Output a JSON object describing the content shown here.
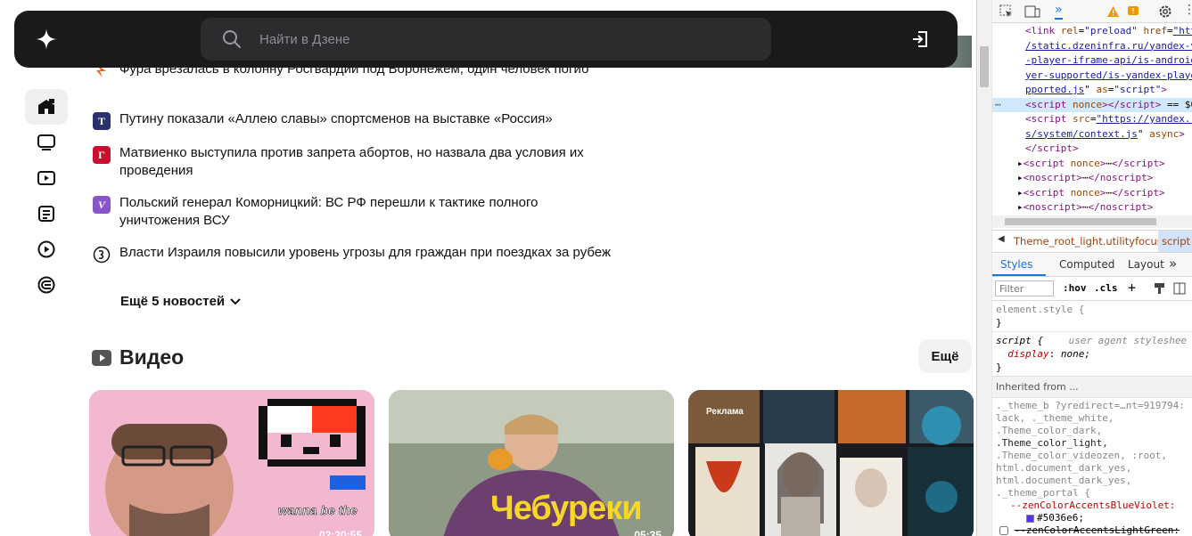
{
  "header": {
    "search_placeholder": "Найти в Дзене"
  },
  "news": [
    {
      "text": "Фура врезалась в колонну Росгвардии под Воронежем, один человек погиб",
      "source_icon": "red-arrow-logo",
      "source_color": "#ff5a1f"
    },
    {
      "text": "Путину показали «Аллею славы» спортсменов на выставке «Россия»",
      "source_icon": "T",
      "source_color": "#2a2f6e"
    },
    {
      "text": "Матвиенко выступила против запрета абортов, но назвала два условия их проведения",
      "source_icon": "Г",
      "source_color": "#c8102e"
    },
    {
      "text": "Польский генерал Коморницкий: ВС РФ перешли к тактике полного уничтожения ВСУ",
      "source_icon": "V",
      "source_color": "#8a55c9"
    },
    {
      "text": "Власти Израиля повысили уровень угрозы для граждан при поездках за рубеж",
      "source_icon": "circle-logo",
      "source_color": "#111111"
    }
  ],
  "more_news_label": "Ещё 5 новостей",
  "video": {
    "title": "Видео",
    "more_label": "Ещё",
    "cards": [
      {
        "duration": "02:20:55",
        "caption": ""
      },
      {
        "duration": "05:35",
        "caption": "Чебуреки"
      },
      {
        "ad_label": "Реклама"
      }
    ]
  },
  "devtools": {
    "dom_lines": [
      {
        "html": "<span class='tag'>&lt;link</span> <span class='attr'>rel</span>=<span class='val'>\"preload\"</span> <span class='attr'>href</span>=<span class='link'>\"htt</span>"
      },
      {
        "html": "<span class='link'>/static.dzeninfra.ru/yandex-v</span>"
      },
      {
        "html": "<span class='link'>-player-iframe-api/is-android</span>"
      },
      {
        "html": "<span class='link'>yer-supported/is-yandex-playe</span>"
      },
      {
        "html": "<span class='link'>pported.js</span>\" <span class='attr'>as</span>=<span class='val'>\"script\"</span><span class='tag'>&gt;</span>"
      },
      {
        "html": "<span class='tag'>&lt;script</span> <span class='attr'>nonce</span><span class='tag'>&gt;&lt;/script&gt;</span> == $0",
        "selected": true
      },
      {
        "html": "<span class='tag'>&lt;script</span> <span class='attr'>src</span>=<span class='link'>\"https://yandex.r</span>"
      },
      {
        "html": "<span class='link'>s/system/context.js</span>\" <span class='attr'>async</span><span class='tag'>&gt;</span>"
      },
      {
        "html": "<span class='tag'>&lt;/script&gt;</span>"
      },
      {
        "html": "▸<span class='tag'>&lt;script</span> <span class='attr'>nonce</span><span class='tag'>&gt;</span>⋯<span class='tag'>&lt;/script&gt;</span>"
      },
      {
        "html": "▸<span class='tag'>&lt;noscript&gt;</span>⋯<span class='tag'>&lt;/noscript&gt;</span>"
      },
      {
        "html": "▸<span class='tag'>&lt;script</span> <span class='attr'>nonce</span><span class='tag'>&gt;</span>⋯<span class='tag'>&lt;/script&gt;</span>"
      },
      {
        "html": "▸<span class='tag'>&lt;noscript&gt;</span>⋯<span class='tag'>&lt;/noscript&gt;</span>"
      }
    ],
    "breadcrumb": "Theme_root_light.utilityfocus",
    "breadcrumb_selected": "script",
    "tabs": [
      "Styles",
      "Computed",
      "Layout"
    ],
    "filter_placeholder": "Filter",
    "hov_label": ":hov",
    "cls_label": ".cls",
    "element_style": "element.style {",
    "script_rule": "script {",
    "user_agent": "user agent styleshee",
    "display_prop": "display",
    "display_val": "none;",
    "inherited_from": "Inherited from ...",
    "theme_lines": [
      "._theme_b    ?yredirect=…nt=919794:",
      "lack, ._theme_white,",
      ".Theme_color_dark,",
      ".Theme_color_light,",
      ".Theme_color_videozen, :root,",
      "html.document_dark_yes,",
      "html.document_dark_yes,",
      "._theme_portal {"
    ],
    "violet_prop": "--zenColorAccentsBlueViolet:",
    "violet_val": "#5036e6;",
    "green_prop": "--zenColorAccentsLightGreen:"
  }
}
